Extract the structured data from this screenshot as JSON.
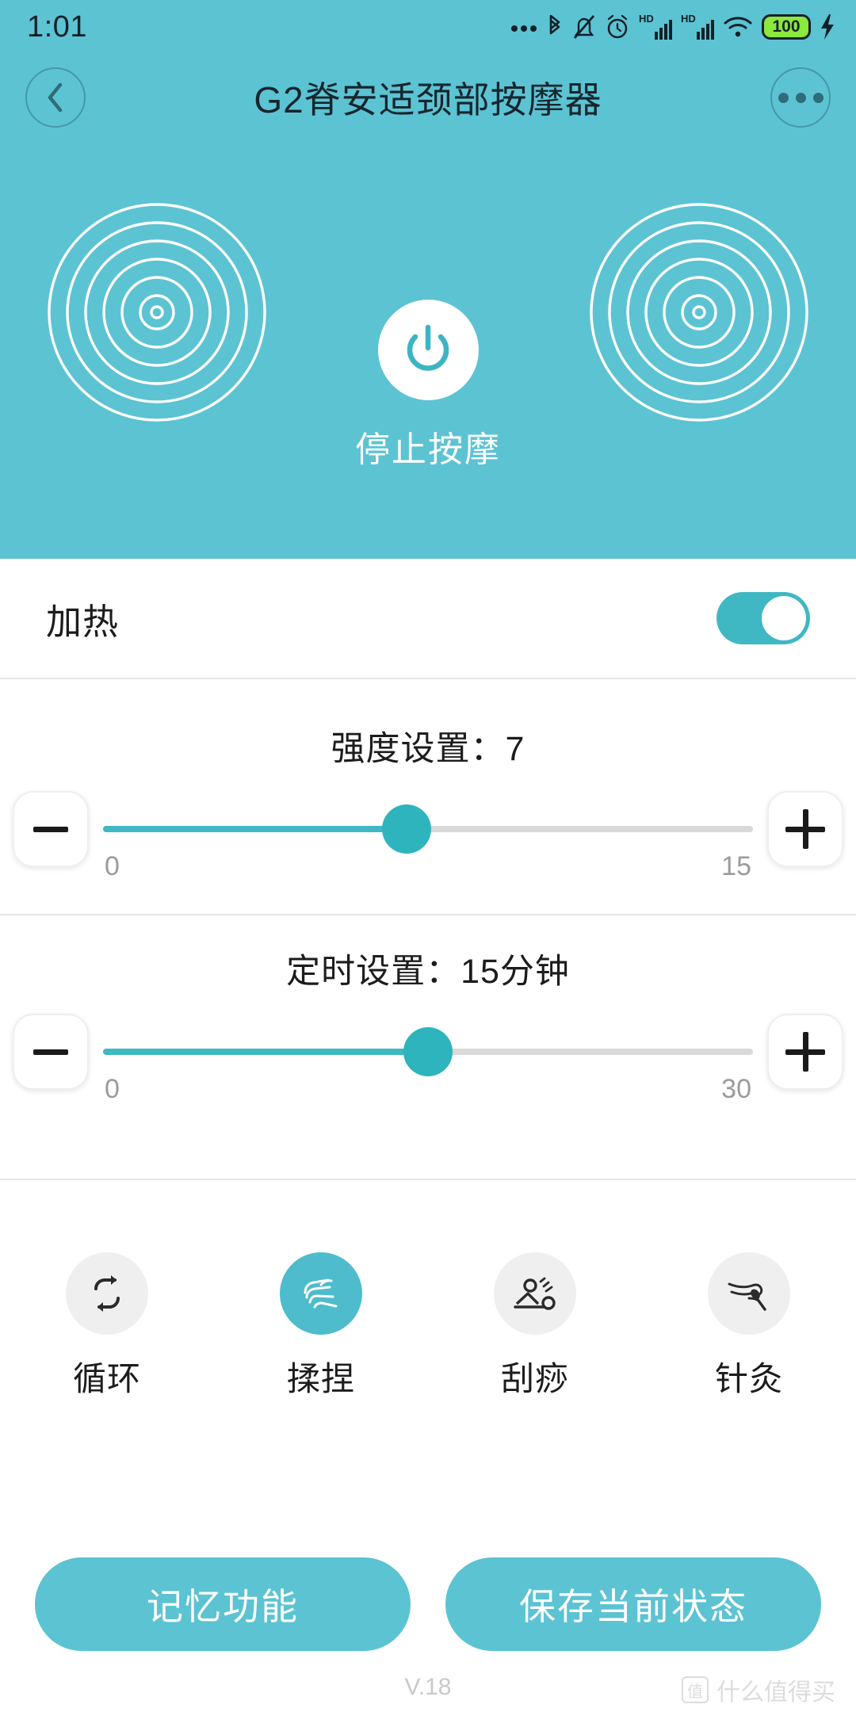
{
  "status_bar": {
    "time": "1:01",
    "icons": [
      "more-dots-icon",
      "bluetooth-icon",
      "vibrate-mute-icon",
      "alarm-icon",
      "hd-signal-1-icon",
      "hd-signal-2-icon",
      "wifi-icon"
    ],
    "battery_level": "100",
    "charging": true
  },
  "header": {
    "back_label": "back-arrow",
    "title": "G2脊安适颈部按摩器",
    "menu_label": "more-options"
  },
  "hero": {
    "power_icon": "power-icon",
    "power_label": "停止按摩",
    "ripple_rings": 6,
    "bg_color": "#5CC3D3"
  },
  "heat": {
    "label": "加热",
    "enabled": true,
    "accent_color": "#3FB8C4"
  },
  "intensity": {
    "title": "强度设置：7",
    "value": 7,
    "min": 0,
    "max": 15,
    "min_label": "0",
    "max_label": "15",
    "decrease_label": "minus-icon",
    "increase_label": "plus-icon"
  },
  "timer": {
    "title": "定时设置：15分钟",
    "value": 15,
    "min": 0,
    "max": 30,
    "min_label": "0",
    "max_label": "30",
    "decrease_label": "minus-icon",
    "increase_label": "plus-icon"
  },
  "modes": [
    {
      "label": "循环",
      "icon": "loop-icon",
      "active": false
    },
    {
      "label": "揉捏",
      "icon": "knead-hand-icon",
      "active": true
    },
    {
      "label": "刮痧",
      "icon": "guasha-icon",
      "active": false
    },
    {
      "label": "针灸",
      "icon": "acupuncture-icon",
      "active": false
    }
  ],
  "actions": {
    "memory_label": "记忆功能",
    "save_label": "保存当前状态",
    "color": "#5CC3D3"
  },
  "footer": {
    "version": "V.18",
    "watermark": "什么值得买",
    "watermark_seal": "值"
  }
}
